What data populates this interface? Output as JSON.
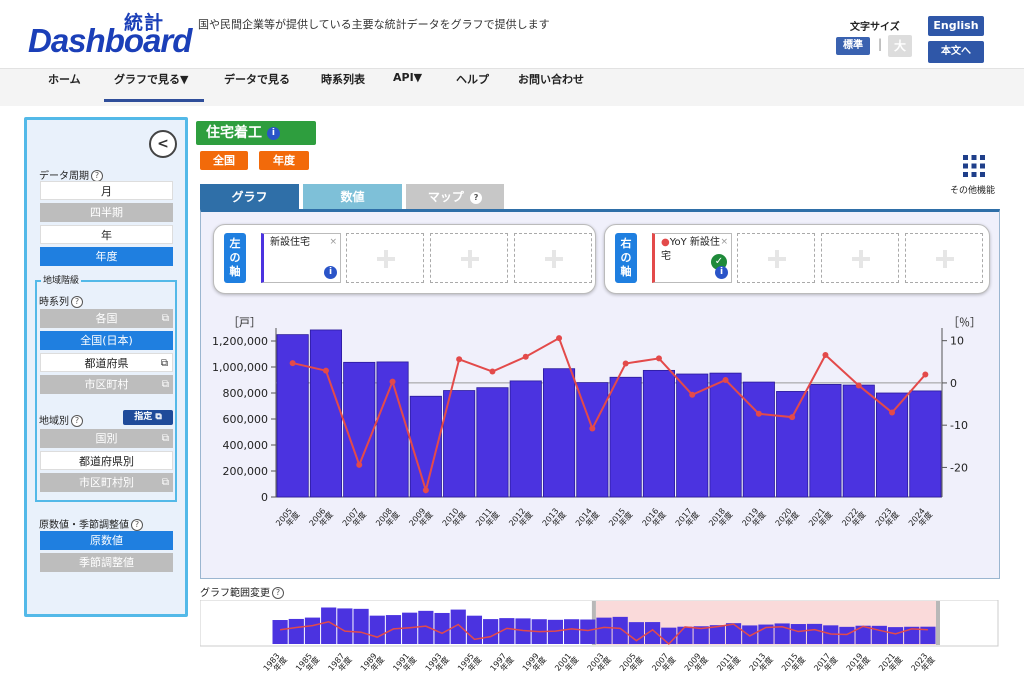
{
  "header": {
    "logo_text": "Dashboard",
    "logo_kanji": "統計",
    "tagline": "国や民間企業等が提供している主要な統計データをグラフで提供します",
    "font_size_label": "文字サイズ",
    "font_std": "標準",
    "font_sep": "|",
    "font_large": "大",
    "english": "English",
    "to_body": "本文へ"
  },
  "nav": {
    "items": [
      "ホーム",
      "グラフで見る▼",
      "データで見る",
      "時系列表",
      "API▼",
      "ヘルプ",
      "お問い合わせ"
    ]
  },
  "sidebar": {
    "collapse_glyph": "<",
    "period_label": "データ周期",
    "period_options": [
      "月",
      "四半期",
      "年",
      "年度"
    ],
    "region_level_label": "地域階級",
    "timeseries_label": "時系列",
    "timeseries_options": [
      "各国",
      "全国(日本)",
      "都道府県",
      "市区町村"
    ],
    "by_region_label": "地域別",
    "designate_button": "指定",
    "by_region_options": [
      "国別",
      "都道府県別",
      "市区町村別"
    ],
    "adjust_label": "原数値・季節調整値",
    "adjust_options": [
      "原数値",
      "季節調整値"
    ],
    "help_glyph": "?",
    "ext_glyph": "⧉"
  },
  "main": {
    "title": "住宅着工",
    "info_glyph": "i",
    "tags": [
      "全国",
      "年度"
    ],
    "more_label": "その他機能",
    "tabs": [
      "グラフ",
      "数値",
      "マップ"
    ],
    "left_axis_label": "左の軸",
    "right_axis_label": "右の軸",
    "left_series": "新設住宅",
    "right_series": "YoY 新設住宅",
    "close_glyph": "×",
    "check_glyph": "✓",
    "range_label": "グラフ範囲変更"
  },
  "colors": {
    "bar": "#4b33e0",
    "bar_stroke": "#2a1a9a",
    "line": "#e34a4a",
    "accent_blue": "#1f7fe0",
    "title_green": "#2e9e3e",
    "tag_orange": "#f26a0a"
  },
  "chart_data": [
    {
      "type": "bar+line",
      "left_unit": "［戸］",
      "right_unit": "［％］",
      "categories": [
        "2005年度",
        "2006年度",
        "2007年度",
        "2008年度",
        "2009年度",
        "2010年度",
        "2011年度",
        "2012年度",
        "2013年度",
        "2014年度",
        "2015年度",
        "2016年度",
        "2017年度",
        "2018年度",
        "2019年度",
        "2020年度",
        "2021年度",
        "2022年度",
        "2023年度",
        "2024年度"
      ],
      "series": [
        {
          "name": "新設住宅",
          "axis": "left",
          "type": "bar",
          "values": [
            1249000,
            1285000,
            1036000,
            1039000,
            775000,
            819000,
            841000,
            893000,
            987000,
            880000,
            921000,
            974000,
            946000,
            953000,
            884000,
            812000,
            866000,
            861000,
            800000,
            816000
          ]
        },
        {
          "name": "YoY 新設住宅",
          "axis": "right",
          "type": "line",
          "values": [
            4.7,
            2.9,
            -19.4,
            0.3,
            -25.4,
            5.6,
            2.7,
            6.2,
            10.6,
            -10.8,
            4.6,
            5.8,
            -2.8,
            0.7,
            -7.3,
            -8.1,
            6.6,
            -0.6,
            -7.0,
            2.0
          ]
        }
      ],
      "left_ticks": [
        "0",
        "200,000",
        "400,000",
        "600,000",
        "800,000",
        "1,000,000",
        "1,200,000"
      ],
      "left_ylim": [
        0,
        1300000
      ],
      "right_ticks": [
        "10",
        "0",
        "-10",
        "-20"
      ],
      "right_ylim": [
        -27,
        13
      ]
    },
    {
      "type": "bar+line",
      "x_ticks": [
        "1983年度",
        "1985年度",
        "1987年度",
        "1989年度",
        "1991年度",
        "1993年度",
        "1995年度",
        "1997年度",
        "1999年度",
        "2001年度",
        "2003年度",
        "2005年度",
        "2007年度",
        "2009年度",
        "2011年度",
        "2013年度",
        "2015年度",
        "2017年度",
        "2019年度",
        "2021年度",
        "2023年度"
      ],
      "selected_range": [
        "2005年度",
        "2024年度"
      ],
      "bar_values": [
        1136000,
        1187000,
        1251000,
        1729000,
        1685000,
        1665000,
        1343000,
        1370000,
        1485000,
        1570000,
        1470000,
        1630000,
        1341000,
        1180000,
        1226000,
        1213000,
        1174000,
        1146000,
        1173000,
        1160000,
        1249000,
        1285000,
        1036000,
        1039000,
        775000,
        819000,
        841000,
        893000,
        987000,
        880000,
        921000,
        974000,
        946000,
        953000,
        884000,
        812000,
        866000,
        861000,
        800000,
        816000,
        820000
      ],
      "line_values": [
        0.5,
        4.5,
        8.0,
        15.0,
        -2.0,
        -4.0,
        -13.0,
        2.0,
        4.0,
        7.0,
        -6.0,
        10.0,
        -17.0,
        -12.0,
        3.0,
        -1.0,
        -3.0,
        -2.0,
        2.0,
        -1.0,
        4.7,
        2.9,
        -19.4,
        0.3,
        -25.4,
        5.6,
        2.7,
        6.2,
        10.6,
        -10.8,
        4.6,
        5.8,
        -2.8,
        0.7,
        -7.3,
        -8.1,
        6.6,
        -0.6,
        -7.0,
        2.0,
        0.5
      ]
    }
  ]
}
